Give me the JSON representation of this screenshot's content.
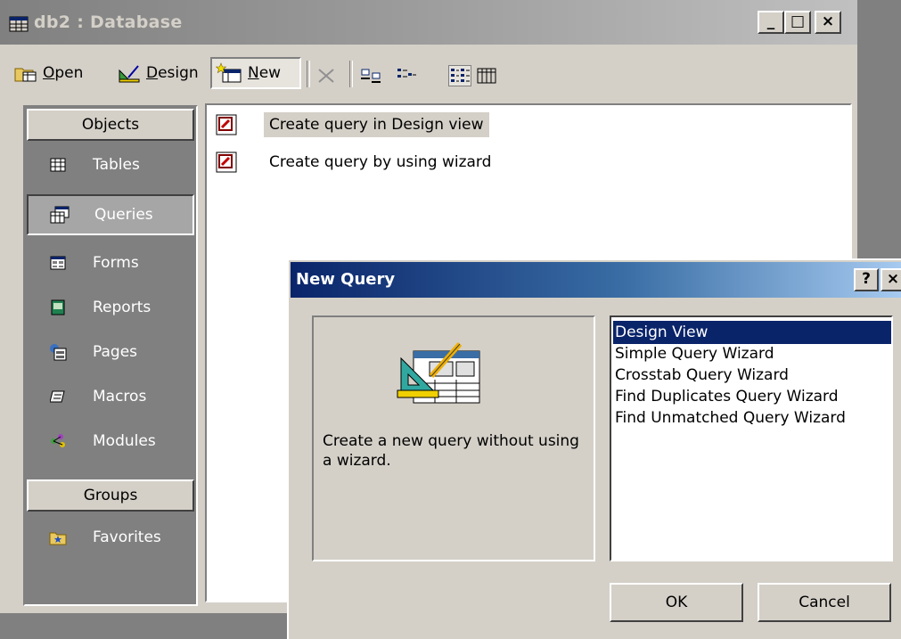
{
  "db_window": {
    "title": "db2 : Database",
    "caption_buttons": {
      "minimize": "_",
      "maximize": "□",
      "close": "×"
    },
    "toolbar": {
      "open_label": "Open",
      "design_label": "Design",
      "new_label": "New",
      "icons": [
        "delete-icon",
        "large-icons-icon",
        "small-icons-icon",
        "list-icon",
        "details-icon"
      ]
    },
    "objects_header": "Objects",
    "groups_header": "Groups",
    "objects": [
      {
        "label": "Tables",
        "icon": "table-icon"
      },
      {
        "label": "Queries",
        "icon": "query-icon",
        "selected": true
      },
      {
        "label": "Forms",
        "icon": "form-icon"
      },
      {
        "label": "Reports",
        "icon": "report-icon"
      },
      {
        "label": "Pages",
        "icon": "page-icon"
      },
      {
        "label": "Macros",
        "icon": "macro-icon"
      },
      {
        "label": "Modules",
        "icon": "module-icon"
      }
    ],
    "groups": [
      {
        "label": "Favorites",
        "icon": "favorites-icon"
      }
    ],
    "list_items": [
      {
        "label": "Create query in Design view",
        "icon": "create-query-icon"
      },
      {
        "label": "Create query by using wizard",
        "icon": "create-query-icon"
      }
    ]
  },
  "dialog": {
    "title": "New Query",
    "help_label": "?",
    "close_label": "×",
    "description": "Create a new query without using a wizard.",
    "options": [
      {
        "label": "Design View",
        "selected": true
      },
      {
        "label": "Simple Query Wizard"
      },
      {
        "label": "Crosstab Query Wizard"
      },
      {
        "label": "Find Duplicates Query Wizard"
      },
      {
        "label": "Find Unmatched Query Wizard"
      }
    ],
    "ok_label": "OK",
    "cancel_label": "Cancel"
  },
  "colors": {
    "face": "#d4d0c8",
    "shadow": "#808080",
    "highlight": "#0a246a",
    "active_title_start": "#0a246a",
    "active_title_end": "#a6caf0"
  }
}
